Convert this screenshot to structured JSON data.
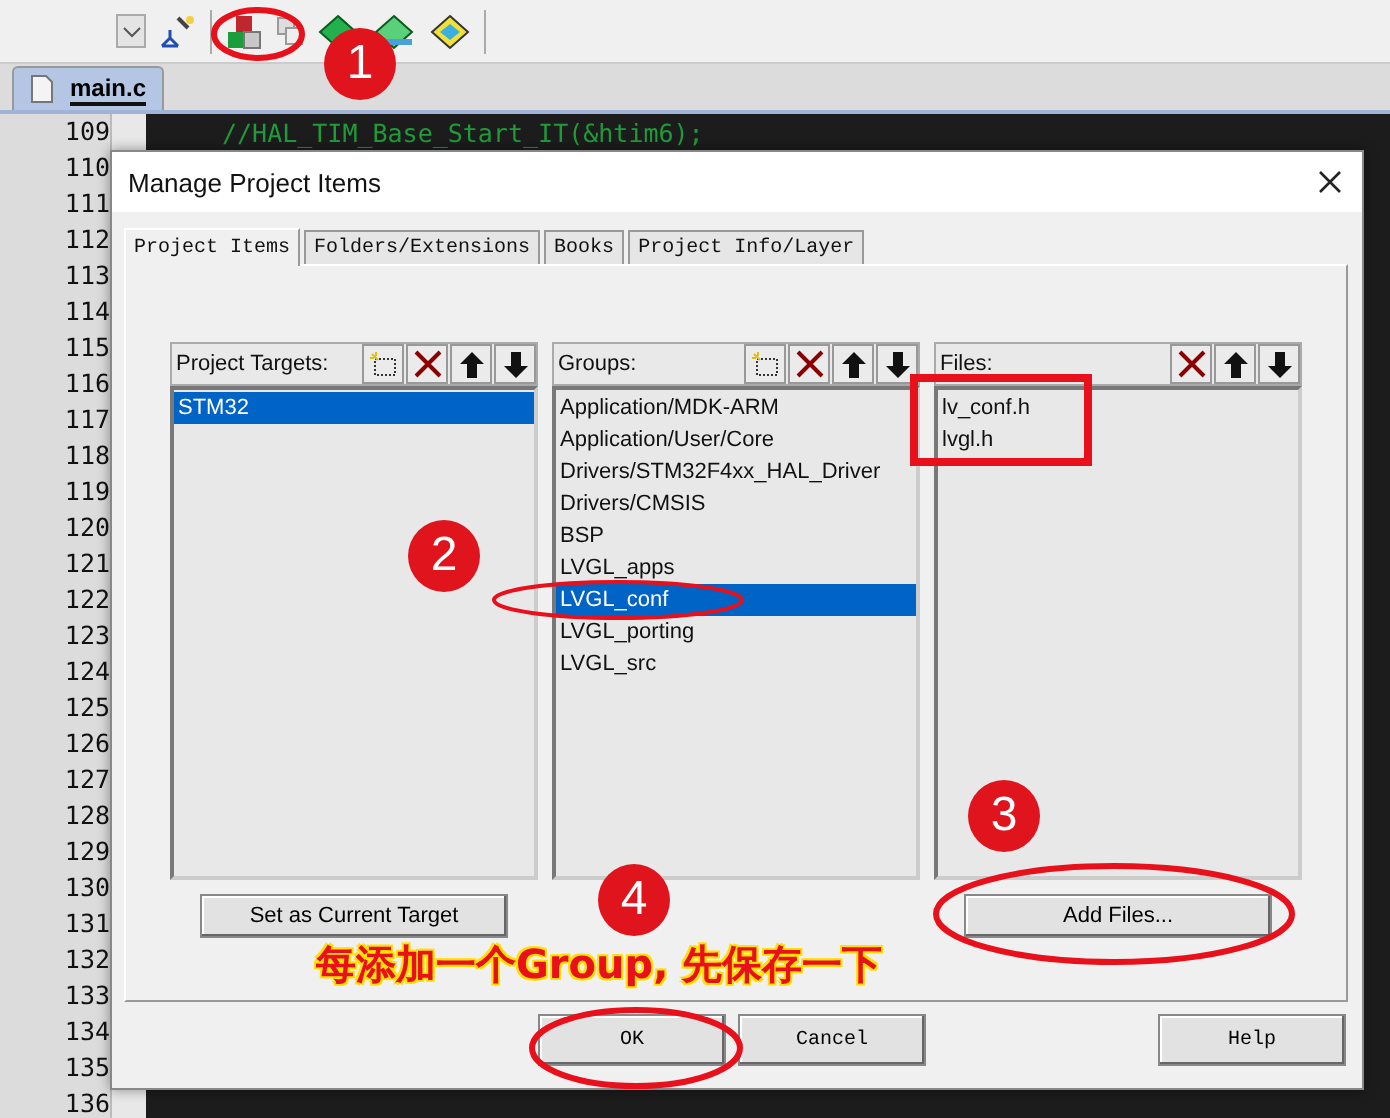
{
  "editor": {
    "tab": {
      "label": "main.c",
      "selected": true
    },
    "lines": [
      {
        "number": "109",
        "code": "//HAL_TIM_Base_Start_IT(&htim6);"
      },
      {
        "number": "110"
      },
      {
        "number": "111"
      },
      {
        "number": "112"
      },
      {
        "number": "113"
      },
      {
        "number": "114"
      },
      {
        "number": "115"
      },
      {
        "number": "116"
      },
      {
        "number": "117"
      },
      {
        "number": "118"
      },
      {
        "number": "119"
      },
      {
        "number": "120"
      },
      {
        "number": "121"
      },
      {
        "number": "122"
      },
      {
        "number": "123"
      },
      {
        "number": "124"
      },
      {
        "number": "125"
      },
      {
        "number": "126"
      },
      {
        "number": "127"
      },
      {
        "number": "128"
      },
      {
        "number": "129"
      },
      {
        "number": "130"
      },
      {
        "number": "131"
      },
      {
        "number": "132"
      },
      {
        "number": "133"
      },
      {
        "number": "134"
      },
      {
        "number": "135"
      },
      {
        "number": "136"
      }
    ]
  },
  "dialog": {
    "title": "Manage Project Items",
    "tabs": [
      {
        "label": "Project Items",
        "selected": true
      },
      {
        "label": "Folders/Extensions",
        "selected": false
      },
      {
        "label": "Books",
        "selected": false
      },
      {
        "label": "Project Info/Layer",
        "selected": false
      }
    ],
    "panels": [
      {
        "label": "Project Targets:",
        "can_add": true,
        "items": [
          {
            "text": "STM32",
            "selected": true
          }
        ],
        "button": "Set as Current Target"
      },
      {
        "label": "Groups:",
        "can_add": true,
        "items": [
          {
            "text": "Application/MDK-ARM",
            "selected": false
          },
          {
            "text": "Application/User/Core",
            "selected": false
          },
          {
            "text": "Drivers/STM32F4xx_HAL_Driver",
            "selected": false
          },
          {
            "text": "Drivers/CMSIS",
            "selected": false
          },
          {
            "text": "BSP",
            "selected": false
          },
          {
            "text": "LVGL_apps",
            "selected": false
          },
          {
            "text": "LVGL_conf",
            "selected": true
          },
          {
            "text": "LVGL_porting",
            "selected": false
          },
          {
            "text": "LVGL_src",
            "selected": false
          }
        ]
      },
      {
        "label": "Files:",
        "can_add": false,
        "items": [
          {
            "text": "lv_conf.h",
            "selected": false
          },
          {
            "text": "lvgl.h",
            "selected": false
          }
        ],
        "button": "Add Files..."
      }
    ],
    "buttons": [
      "OK",
      "Cancel",
      "Help"
    ]
  },
  "annotations": {
    "markers": [
      "1",
      "2",
      "3",
      "4"
    ],
    "caption": "每添加一个Group, 先保存一下"
  }
}
